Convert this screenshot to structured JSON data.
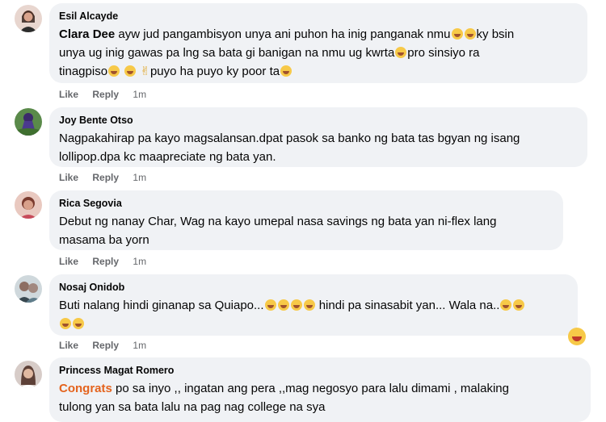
{
  "comments": [
    {
      "author": "Esil Alcayde",
      "mention": "Clara Dee",
      "line1": "ayw jud pangambisyon unya ani puhon ha inig panganak nmu",
      "line1b": "ky bsin",
      "line2": "unya ug inig gawas pa lng sa bata gi banigan na nmu ug kwrta",
      "line2b": "pro sinsiyo ra",
      "line3": "tinagpiso",
      "line3b": "puyo ha puyo ky poor ta",
      "like": "Like",
      "reply": "Reply",
      "time": "1m"
    },
    {
      "author": "Joy Bente Otso",
      "line1": "Nagpakahirap pa kayo magsalansan.dpat pasok sa banko ng bata tas bgyan ng isang",
      "line2": "lollipop.dpa kc maapreciate ng bata yan.",
      "like": "Like",
      "reply": "Reply",
      "time": "1m"
    },
    {
      "author": "Rica Segovia",
      "line1": "Debut ng nanay Char, Wag na kayo umepal nasa savings ng bata yan ni-flex lang",
      "line2": "masama ba yorn",
      "like": "Like",
      "reply": "Reply",
      "time": "1m"
    },
    {
      "author": "Nosaj Onidob",
      "line1a": "Buti nalang hindi ginanap sa Quiapo...",
      "line1b": "hindi pa sinasabit yan... Wala na..",
      "like": "Like",
      "reply": "Reply",
      "time": "1m"
    },
    {
      "author": "Princess Magat Romero",
      "mention": "Congrats",
      "line1": "po sa inyo ,, ingatan ang pera ,,mag negosyo para lalu dimami , malaking",
      "line2": "tulong yan sa bata lalu na pag nag college na sya"
    }
  ],
  "colors": {
    "bubble": "#f0f2f5",
    "meta": "#65676b",
    "mention_orange": "#e4631d"
  }
}
